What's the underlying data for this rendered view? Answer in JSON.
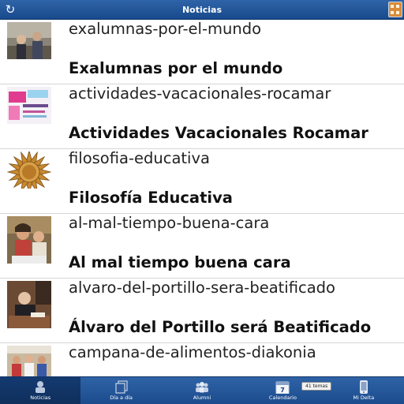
{
  "header": {
    "title": "Noticias",
    "refresh_icon": "refresh-icon",
    "apps_icon": "apps-icon"
  },
  "news": [
    {
      "slug": "exalumnas-por-el-mundo",
      "headline": "Exalumnas por el mundo",
      "thumb": "photo-group"
    },
    {
      "slug": "actividades-vacacionales-rocamar",
      "headline": "Actividades Vacacionales Rocamar",
      "thumb": "poster-pink"
    },
    {
      "slug": "filosofia-educativa",
      "headline": "Filosofía Educativa",
      "thumb": "sunflower-logo"
    },
    {
      "slug": "al-mal-tiempo-buena-cara",
      "headline": "Al mal tiempo buena cara",
      "thumb": "photo-children"
    },
    {
      "slug": "alvaro-del-portillo-sera-beatificado",
      "headline": "Álvaro del Portillo será Beatificado",
      "thumb": "photo-portrait"
    },
    {
      "slug": "campana-de-alimentos-diakonia",
      "headline": "",
      "thumb": "photo-people"
    }
  ],
  "tabs": [
    {
      "label": "Noticias",
      "icon": "news-icon",
      "active": true
    },
    {
      "label": "Día a día",
      "icon": "pages-icon",
      "active": false
    },
    {
      "label": "Alumni",
      "icon": "group-icon",
      "active": false
    },
    {
      "label": "Calendario",
      "icon": "calendar-icon",
      "active": false,
      "calendar_day": "7"
    },
    {
      "label": "Mi Delta",
      "icon": "phone-icon",
      "active": false
    }
  ],
  "calendar_badge": "41 temas",
  "colors": {
    "bar": "#1f53961",
    "active_tab": "#143a70",
    "sunflower": "#c8892f"
  }
}
